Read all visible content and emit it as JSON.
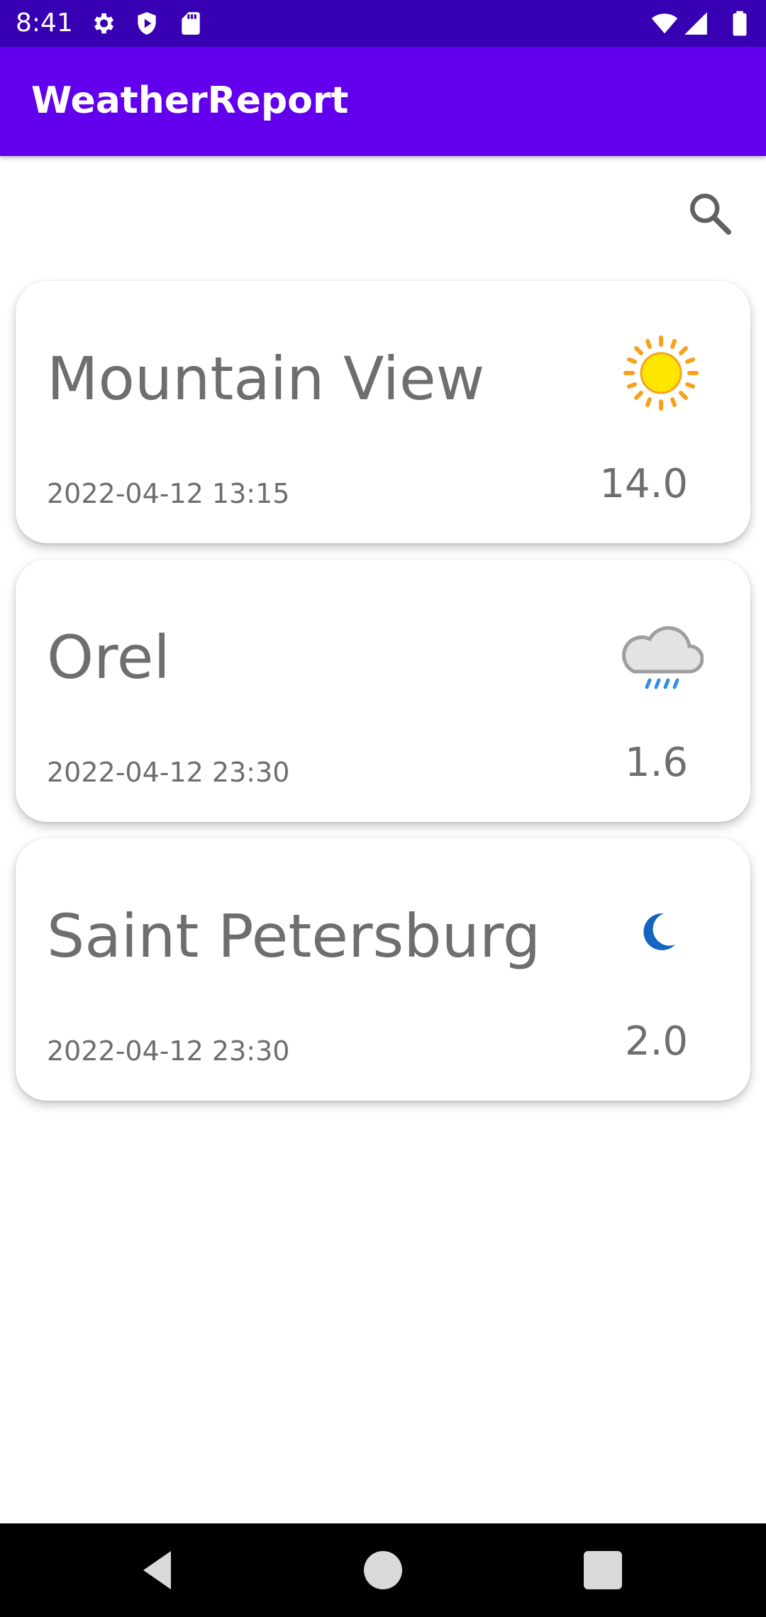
{
  "status_bar": {
    "time": "8:41",
    "icons": [
      "settings-icon",
      "shield-icon",
      "sd-card-icon",
      "wifi-icon",
      "signal-icon",
      "battery-icon"
    ],
    "background_color": "#3700b3"
  },
  "app_bar": {
    "title": "WeatherReport",
    "background_color": "#6200ee"
  },
  "search": {
    "icon": "search-icon"
  },
  "cities": [
    {
      "city": "Mountain View",
      "date": "2022-04-12 13:15",
      "temperature": "14.0",
      "icon": "sun-icon"
    },
    {
      "city": "Orel",
      "date": "2022-04-12 23:30",
      "temperature": "1.6",
      "icon": "rain-cloud-icon"
    },
    {
      "city": "Saint Petersburg",
      "date": "2022-04-12 23:30",
      "temperature": "2.0",
      "icon": "moon-icon"
    }
  ],
  "nav_bar": {
    "buttons": [
      "back-icon",
      "home-icon",
      "recents-icon"
    ]
  }
}
